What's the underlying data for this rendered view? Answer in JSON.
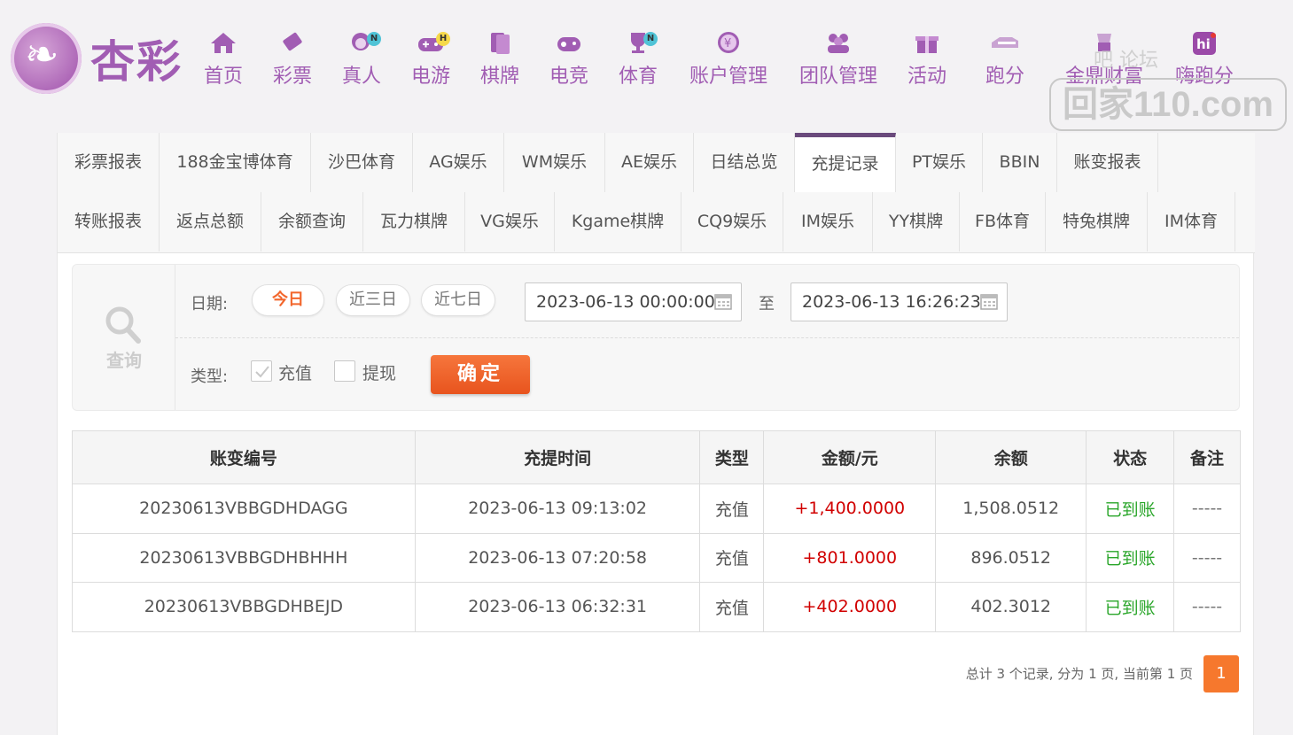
{
  "brand": {
    "name": "杏彩"
  },
  "nav": [
    {
      "label": "首页",
      "icon": "home-icon"
    },
    {
      "label": "彩票",
      "icon": "ticket-icon"
    },
    {
      "label": "真人",
      "icon": "dealer-icon",
      "badge": "N"
    },
    {
      "label": "电游",
      "icon": "gamepad-icon",
      "badge": "H"
    },
    {
      "label": "棋牌",
      "icon": "cards-icon"
    },
    {
      "label": "电竞",
      "icon": "esports-gamepad-icon"
    },
    {
      "label": "体育",
      "icon": "trophy-icon",
      "badge": "N"
    },
    {
      "label": "账户管理",
      "icon": "yen-coin-icon"
    },
    {
      "label": "团队管理",
      "icon": "team-icon"
    },
    {
      "label": "活动",
      "icon": "gift-icon"
    },
    {
      "label": "跑分",
      "icon": "run-score-icon"
    },
    {
      "label": "金鼎财富",
      "icon": "wealth-icon"
    },
    {
      "label": "嗨跑分",
      "icon": "hi-run-icon"
    }
  ],
  "watermark": {
    "text": "回家110.com",
    "top_text": "吧 论坛"
  },
  "tabs_row1": [
    "彩票报表",
    "188金宝博体育",
    "沙巴体育",
    "AG娱乐",
    "WM娱乐",
    "AE娱乐",
    "日结总览",
    "充提记录",
    "PT娱乐",
    "BBIN",
    "账变报表"
  ],
  "tabs_row2": [
    "转账报表",
    "返点总额",
    "余额查询",
    "瓦力棋牌",
    "VG娱乐",
    "Kgame棋牌",
    "CQ9娱乐",
    "IM娱乐",
    "YY棋牌",
    "FB体育",
    "特兔棋牌",
    "IM体育"
  ],
  "active_tab": "充提记录",
  "search": {
    "side_label": "查询",
    "date_label": "日期:",
    "quick_dates": [
      "今日",
      "近三日",
      "近七日"
    ],
    "active_quick_date": "今日",
    "start": "2023-06-13 00:00:00",
    "to_label": "至",
    "end": "2023-06-13 16:26:23",
    "type_label": "类型:",
    "types": [
      {
        "label": "充值",
        "checked": true
      },
      {
        "label": "提现",
        "checked": false
      }
    ],
    "confirm_label": "确定"
  },
  "table": {
    "headers": [
      "账变编号",
      "充提时间",
      "类型",
      "金额/元",
      "余额",
      "状态",
      "备注"
    ],
    "rows": [
      {
        "id": "20230613VBBGDHDAGG",
        "time": "2023-06-13 09:13:02",
        "type": "充值",
        "amount": "+1,400.0000",
        "balance": "1,508.0512",
        "status": "已到账",
        "note": "-----"
      },
      {
        "id": "20230613VBBGDHBHHH",
        "time": "2023-06-13 07:20:58",
        "type": "充值",
        "amount": "+801.0000",
        "balance": "896.0512",
        "status": "已到账",
        "note": "-----"
      },
      {
        "id": "20230613VBBGDHBEJD",
        "time": "2023-06-13 06:32:31",
        "type": "充值",
        "amount": "+402.0000",
        "balance": "402.3012",
        "status": "已到账",
        "note": "-----"
      }
    ]
  },
  "pager": {
    "summary": "总计 3 个记录, 分为 1 页, 当前第 1 页",
    "current": "1"
  },
  "colors": {
    "brand": "#a15db3",
    "accent": "#f2662c",
    "amount": "#d10000",
    "status_ok": "#2aa62a"
  }
}
